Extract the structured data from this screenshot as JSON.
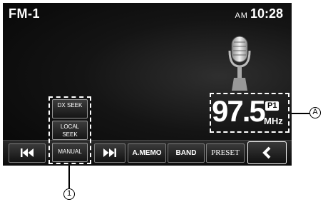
{
  "header": {
    "band": "FM-1",
    "ampm": "AM",
    "time": "10:28"
  },
  "tuner": {
    "frequency": "97.5",
    "preset": "P1",
    "unit": "MHz"
  },
  "side_buttons": {
    "dx_seek": "DX SEEK",
    "local_seek": "LOCAL SEEK",
    "manual": "MANUAL"
  },
  "bottom_bar": {
    "prev_icon": "skip-previous-icon",
    "next_icon": "skip-next-icon",
    "amemo": "A.MEMO",
    "band": "BAND",
    "preset": "PRESET",
    "back_icon": "back-arrow-icon"
  },
  "callouts": {
    "marker_a": "A",
    "marker_1": "1"
  },
  "colors": {
    "screen_background": "#0a0a0a",
    "text": "#ffffff",
    "callout": "#000000"
  }
}
